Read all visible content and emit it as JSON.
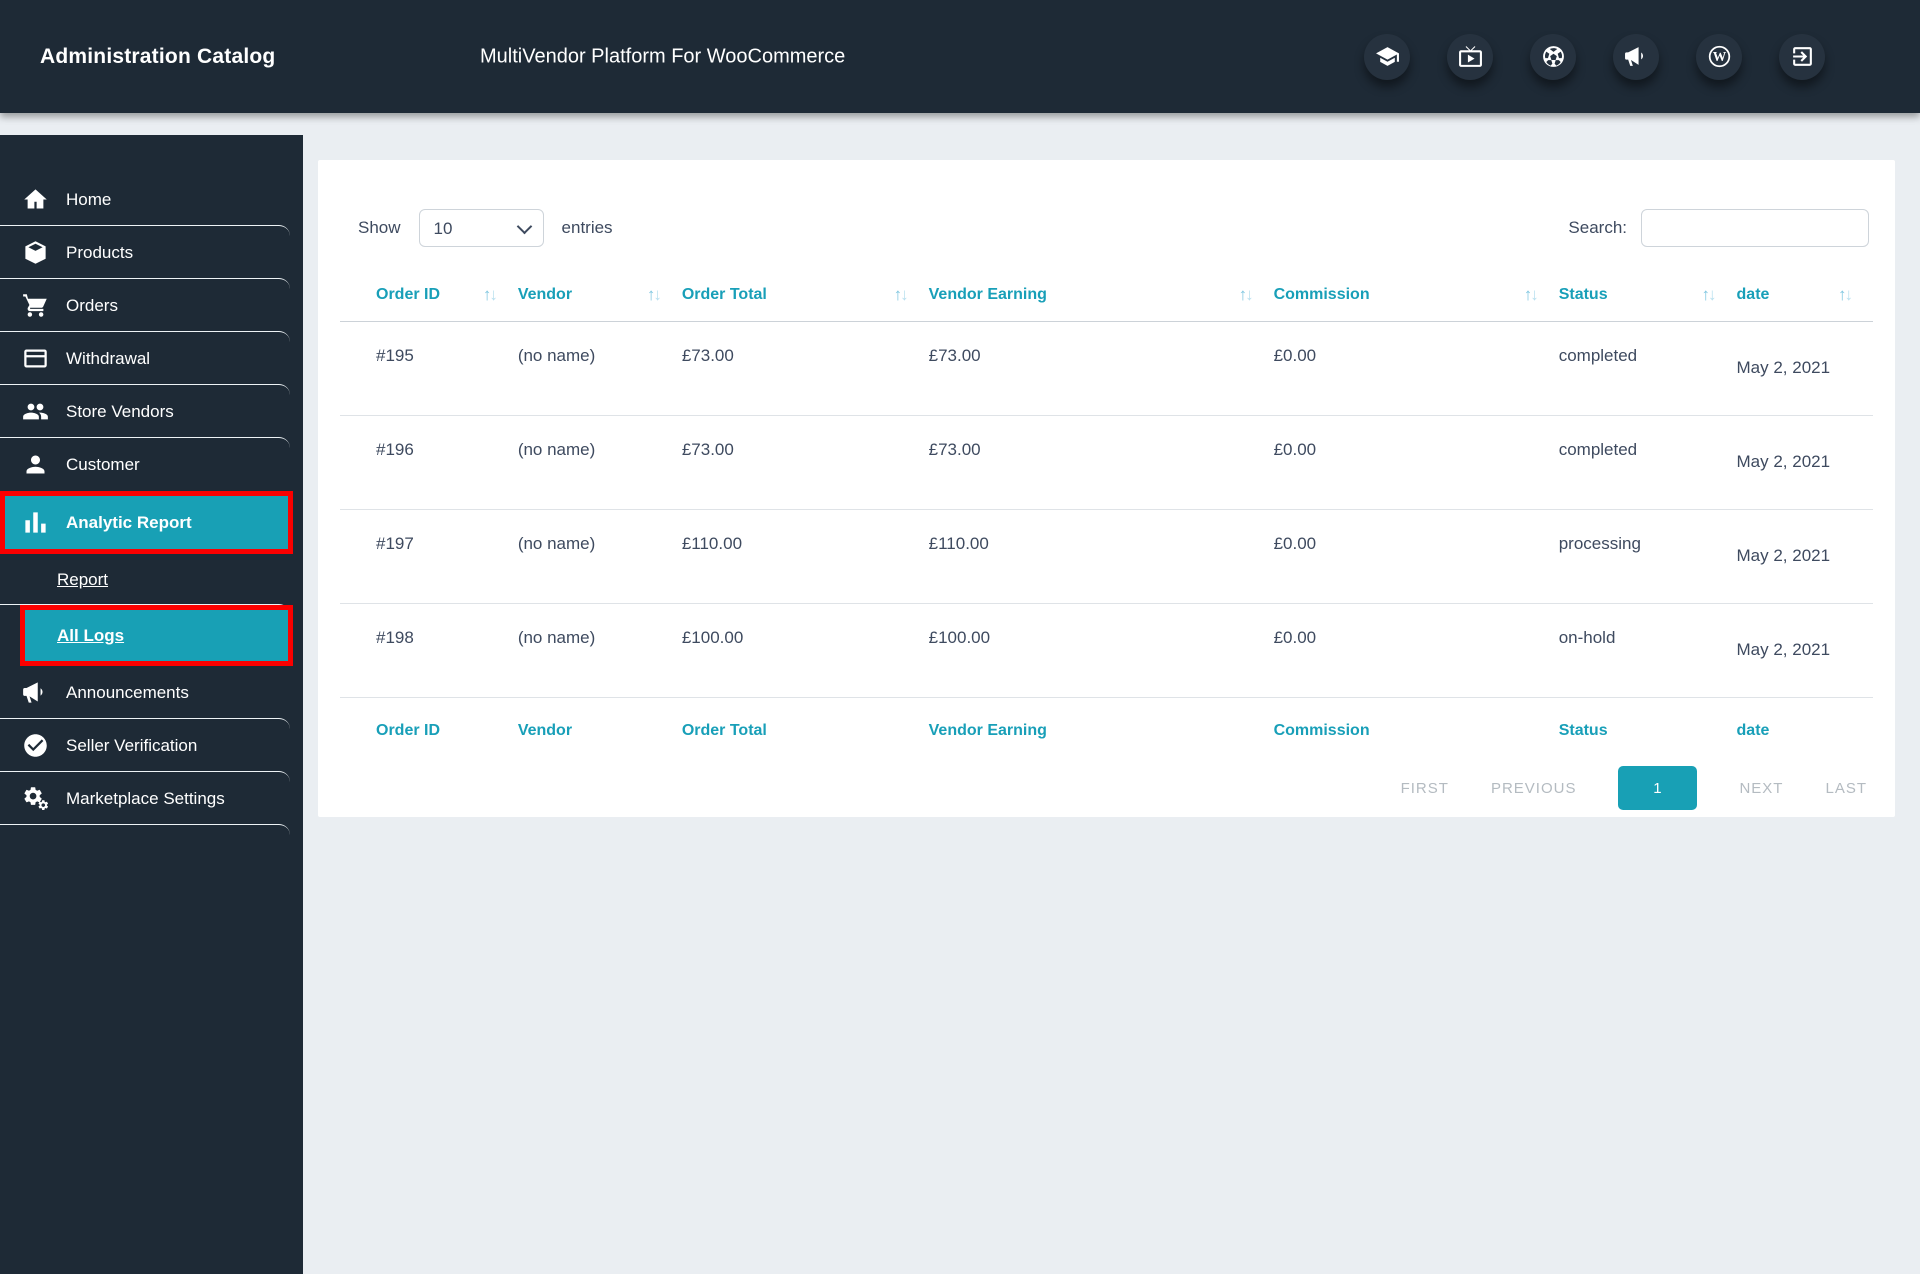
{
  "app": {
    "brand": "Administration Catalog",
    "title": "MultiVendor Platform For WooCommerce"
  },
  "header_icons": [
    "education-icon",
    "live-tv-icon",
    "soccer-ball-icon",
    "megaphone-icon",
    "wordpress-icon",
    "exit-icon"
  ],
  "sidebar": {
    "items": [
      {
        "label": "Home",
        "icon": "home-icon"
      },
      {
        "label": "Products",
        "icon": "box-icon"
      },
      {
        "label": "Orders",
        "icon": "cart-icon"
      },
      {
        "label": "Withdrawal",
        "icon": "credit-card-icon"
      },
      {
        "label": "Store Vendors",
        "icon": "users-icon"
      },
      {
        "label": "Customer",
        "icon": "user-icon"
      },
      {
        "label": "Analytic Report",
        "icon": "bar-chart-icon"
      },
      {
        "label": "Report"
      },
      {
        "label": "All Logs"
      },
      {
        "label": "Announcements",
        "icon": "megaphone-icon"
      },
      {
        "label": "Seller Verification",
        "icon": "check-circle-icon"
      },
      {
        "label": "Marketplace Settings",
        "icon": "gears-icon"
      }
    ]
  },
  "content": {
    "show_label": "Show",
    "entries_label": "entries",
    "page_size": "10",
    "search_label": "Search:",
    "table": {
      "columns": [
        "Order ID",
        "Vendor",
        "Order Total",
        "Vendor Earning",
        "Commission",
        "Status",
        "date"
      ],
      "rows": [
        {
          "order_id": "#195",
          "vendor": "(no name)",
          "order_total": "£73.00",
          "vendor_earning": "£73.00",
          "commission": "£0.00",
          "status": "completed",
          "date": "May 2, 2021"
        },
        {
          "order_id": "#196",
          "vendor": "(no name)",
          "order_total": "£73.00",
          "vendor_earning": "£73.00",
          "commission": "£0.00",
          "status": "completed",
          "date": "May 2, 2021"
        },
        {
          "order_id": "#197",
          "vendor": "(no name)",
          "order_total": "£110.00",
          "vendor_earning": "£110.00",
          "commission": "£0.00",
          "status": "processing",
          "date": "May 2, 2021"
        },
        {
          "order_id": "#198",
          "vendor": "(no name)",
          "order_total": "£100.00",
          "vendor_earning": "£100.00",
          "commission": "£0.00",
          "status": "on-hold",
          "date": "May 2, 2021"
        }
      ]
    },
    "pagination": {
      "first": "FIRST",
      "previous": "PREVIOUS",
      "page": "1",
      "next": "NEXT",
      "last": "LAST"
    }
  },
  "colors": {
    "header_bg": "#1e2a36",
    "accent_teal": "#18a0b5",
    "highlight_red": "#fb0000",
    "table_header_text": "#189fb8"
  }
}
